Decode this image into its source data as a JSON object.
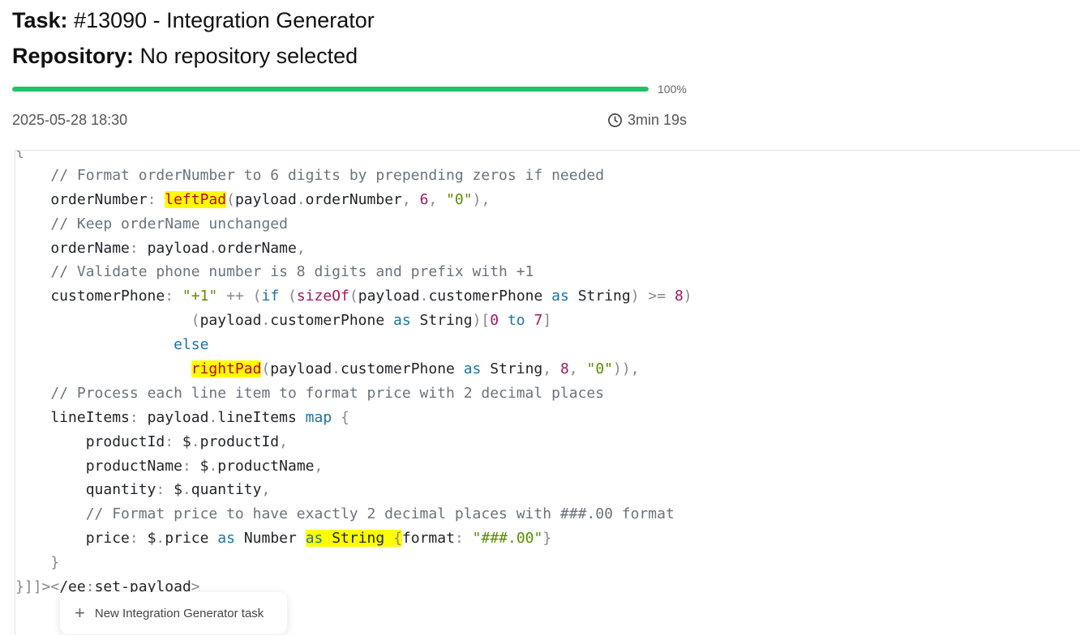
{
  "task": {
    "label": "Task:",
    "value": "#13090 - Integration Generator"
  },
  "repository": {
    "label": "Repository:",
    "value": "No repository selected"
  },
  "progress": {
    "percent": 100,
    "label": "100%",
    "color": "#1fc266"
  },
  "meta": {
    "timestamp": "2025-05-28 18:30",
    "duration": "3min 19s",
    "duration_icon": "clock-icon"
  },
  "code": {
    "lines": [
      "{",
      "    // Format orderNumber to 6 digits by prepending zeros if needed",
      "    orderNumber: leftPad(payload.orderNumber, 6, \"0\"),",
      "    // Keep orderName unchanged",
      "    orderName: payload.orderName,",
      "    // Validate phone number is 8 digits and prefix with +1",
      "    customerPhone: \"+1\" ++ (if (sizeOf(payload.customerPhone as String) >= 8)",
      "                    (payload.customerPhone as String)[0 to 7]",
      "                  else",
      "                    rightPad(payload.customerPhone as String, 8, \"0\")),",
      "    // Process each line item to format price with 2 decimal places",
      "    lineItems: payload.lineItems map {",
      "        productId: $.productId,",
      "        productName: $.productName,",
      "        quantity: $.quantity,",
      "        // Format price to have exactly 2 decimal places with ###.00 format",
      "        price: $.price as Number as String {format: \"###.00\"}",
      "    }",
      "}]]></ee:set-payload>"
    ],
    "highlight_color": "#ffff00"
  },
  "new_task_button": {
    "icon": "plus-icon",
    "label": "New Integration Generator task"
  }
}
